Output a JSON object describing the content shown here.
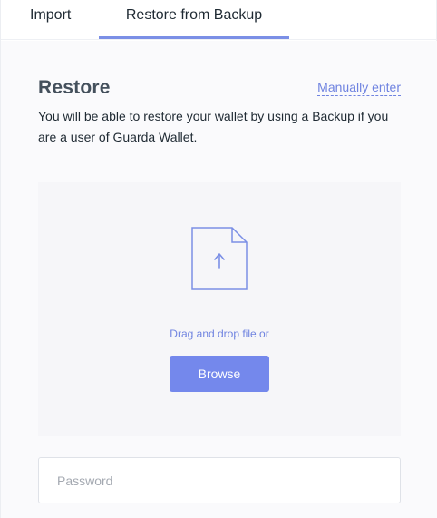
{
  "tabs": {
    "import_label": "Import",
    "restore_label": "Restore from Backup",
    "active": "restore"
  },
  "restore": {
    "title": "Restore",
    "manual_link": "Manually enter",
    "description": "You will be able to restore your wallet by using a Backup if you are a user of Guarda Wallet.",
    "dropzone": {
      "icon": "file-upload-icon",
      "drag_text": "Drag and drop file or",
      "browse_label": "Browse"
    },
    "password": {
      "placeholder": "Password",
      "value": ""
    }
  },
  "colors": {
    "accent": "#7488ec",
    "link": "#6f83e0",
    "title": "#44505c",
    "dropzone_bg": "#f6f6f9"
  }
}
